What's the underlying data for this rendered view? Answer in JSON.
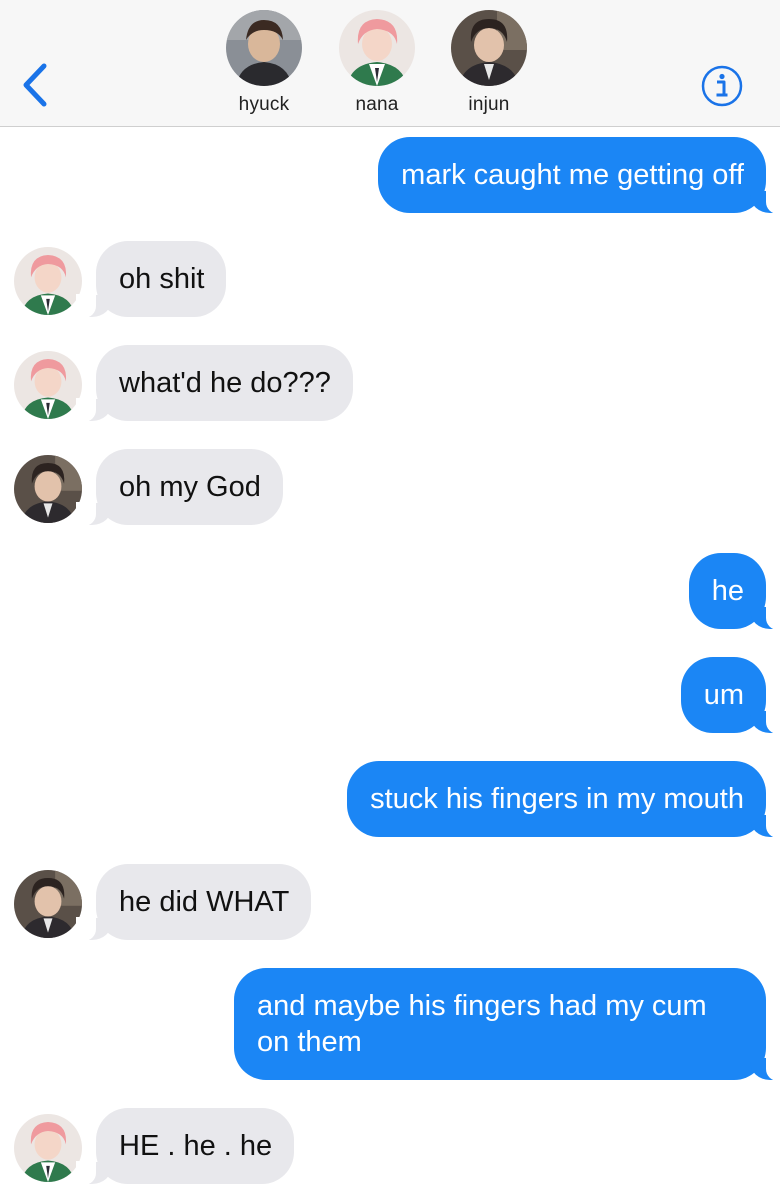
{
  "header": {
    "contacts": [
      {
        "name": "hyuck",
        "avatar": "hyuck-avatar"
      },
      {
        "name": "nana",
        "avatar": "nana-avatar"
      },
      {
        "name": "injun",
        "avatar": "injun-avatar"
      }
    ],
    "back_icon": "chevron-left-icon",
    "info_icon": "info-icon"
  },
  "colors": {
    "outgoing_bubble": "#1b86f5",
    "incoming_bubble": "#e8e8ec",
    "accent": "#1a73e8"
  },
  "messages": [
    {
      "from": "me",
      "text": "mark caught me getting off"
    },
    {
      "from": "nana",
      "text": "oh shit"
    },
    {
      "from": "nana",
      "text": "what'd he do???"
    },
    {
      "from": "injun",
      "text": "oh my God"
    },
    {
      "from": "me",
      "text": "he"
    },
    {
      "from": "me",
      "text": "um"
    },
    {
      "from": "me",
      "text": "stuck his fingers in my mouth"
    },
    {
      "from": "injun",
      "text": "he did WHAT"
    },
    {
      "from": "me",
      "text": "and maybe his fingers had my cum on them"
    },
    {
      "from": "nana",
      "text": "HE . he . he"
    }
  ]
}
